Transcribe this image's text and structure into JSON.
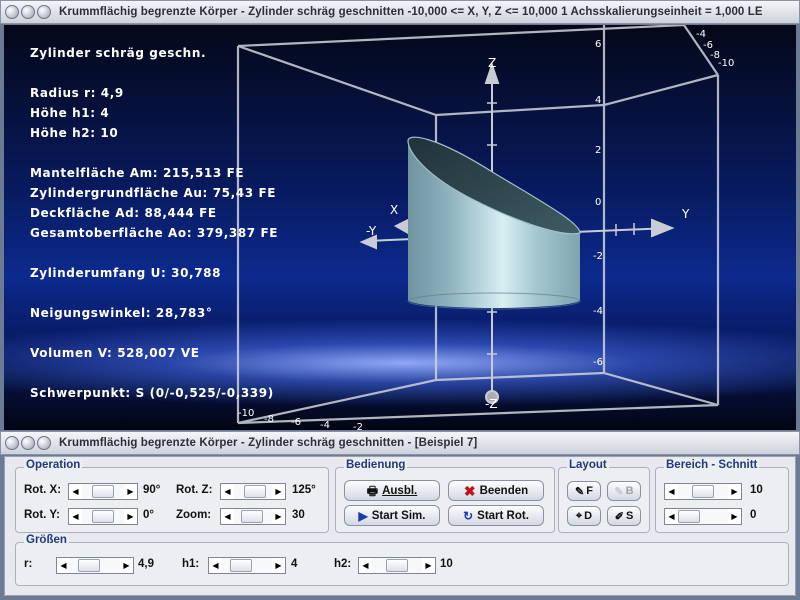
{
  "window_top": {
    "title": "Krummflächig begrenzte Körper - Zylinder schräg geschnitten   -10,000 <= X, Y, Z <= 10,000    1 Achsskalierungseinheit = 1,000 LE"
  },
  "view": {
    "info": {
      "heading": "Zylinder schräg geschn.",
      "radius": "Radius r: 4,9",
      "h1": "Höhe h1: 4",
      "h2": "Höhe h2: 10",
      "mantel": "Mantelfläche Am: 215,513 FE",
      "grund": "Zylindergrundfläche Au: 75,43 FE",
      "deck": "Deckfläche Ad: 88,444 FE",
      "gesamt": "Gesamtoberfläche Ao: 379,387 FE",
      "umfang": "Zylinderumfang U: 30,788",
      "neigung": "Neigungswinkel: 28,783°",
      "volumen": "Volumen V: 528,007 VE",
      "schwerpunkt": "Schwerpunkt: S (0/-0,525/-0,339)"
    },
    "axes": {
      "z_top": "Z",
      "z_bottom": "-Z",
      "y_right": "Y",
      "y_left": "-Y",
      "x": "X"
    },
    "z_ticks": [
      "6",
      "4",
      "2",
      "0",
      "-2",
      "-4",
      "-6",
      "-8",
      "-10"
    ],
    "y_ticks_topright": [
      "-4",
      "-6",
      "-8",
      "-10"
    ],
    "x_ticks_bottom": [
      "-10",
      "-8",
      "-6",
      "-4",
      "-2"
    ],
    "colors": {
      "cylinder": "#8fb6c2",
      "background": "#0c2a8e",
      "axis": "#c8ccd4"
    }
  },
  "window_bottom": {
    "title": "Krummflächig begrenzte Körper - Zylinder schräg geschnitten - [Beispiel 7]"
  },
  "panel": {
    "operation": {
      "label": "Operation",
      "rotx_label": "Rot. X:",
      "rotx_value": "90°",
      "rotx": 0.5,
      "roty_label": "Rot. Y:",
      "roty_value": "0°",
      "roty": 0.5,
      "rotz_label": "Rot. Z:",
      "rotz_value": "125°",
      "rotz": 0.65,
      "zoom_label": "Zoom:",
      "zoom_value": "30",
      "zoom": 0.45
    },
    "bedienung": {
      "label": "Bedienung",
      "ausbl": "Ausbl.",
      "beenden": "Beenden",
      "start_sim": "Start Sim.",
      "start_rot": "Start Rot."
    },
    "layout": {
      "label": "Layout",
      "f": "F",
      "b": "B",
      "d": "D",
      "s": "S"
    },
    "bereich": {
      "label": "Bereich - Schnitt",
      "v1": "10",
      "v1_level": 0.5,
      "v2": "0",
      "v2_level": 0.0
    },
    "groessen": {
      "label": "Größen",
      "r_label": "r:",
      "r_value": "4,9",
      "r_level": 0.3,
      "h1_label": "h1:",
      "h1_value": "4",
      "h1_level": 0.3,
      "h2_label": "h2:",
      "h2_value": "10",
      "h2_level": 0.5
    }
  }
}
